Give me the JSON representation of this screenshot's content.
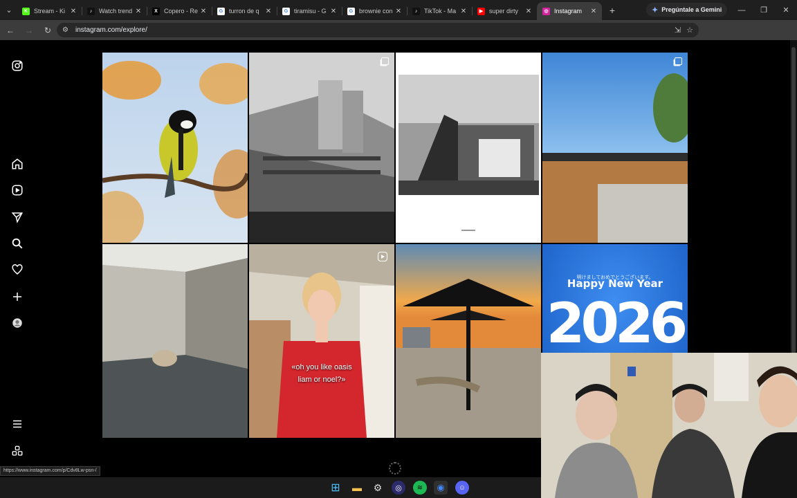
{
  "browser": {
    "tabs": [
      {
        "title": "Stream - Ki",
        "favicon": "kick-icon",
        "color": "#53fc18",
        "glyph": "K"
      },
      {
        "title": "Watch trend",
        "favicon": "tiktok-icon",
        "color": "#111111",
        "glyph": "♪"
      },
      {
        "title": "Copero - Re",
        "favicon": "x-icon",
        "color": "#000000",
        "glyph": "X"
      },
      {
        "title": "turron de q",
        "favicon": "google-icon",
        "color": "#ffffff",
        "glyph": "G"
      },
      {
        "title": "tiramisu - G",
        "favicon": "google-icon",
        "color": "#ffffff",
        "glyph": "G"
      },
      {
        "title": "brownie con",
        "favicon": "google-icon",
        "color": "#ffffff",
        "glyph": "G"
      },
      {
        "title": "TikTok - Ma",
        "favicon": "tiktok-icon",
        "color": "#111111",
        "glyph": "♪"
      },
      {
        "title": "super dirty",
        "favicon": "youtube-icon",
        "color": "#ff0000",
        "glyph": "▶"
      },
      {
        "title": "Instagram",
        "favicon": "instagram-icon",
        "color": "#d6249f",
        "glyph": "◎",
        "active": true
      }
    ],
    "gemini_label": "Pregúntale a Gemini",
    "url": "instagram.com/explore/",
    "status_url": "https://www.instagram.com/p/Cdv8Lw-psn-/"
  },
  "sidebar": {
    "items": [
      "instagram-logo-icon",
      "home-icon",
      "reels-icon",
      "messages-icon",
      "search-icon",
      "notifications-icon",
      "create-icon",
      "profile-avatar",
      "more-menu-icon",
      "also-from-meta-icon"
    ]
  },
  "posts": [
    {
      "name": "post-bird",
      "kind": "photo"
    },
    {
      "name": "post-brutalist-building",
      "kind": "carousel"
    },
    {
      "name": "post-modern-house-bw",
      "kind": "photo"
    },
    {
      "name": "post-wood-concrete-wall",
      "kind": "carousel"
    },
    {
      "name": "post-stone-courtyard",
      "kind": "photo"
    },
    {
      "name": "post-red-polo-reel",
      "kind": "reel",
      "caption_line1": "«oh you like oasis",
      "caption_line2": "liam or noel?»"
    },
    {
      "name": "post-beach-umbrella",
      "kind": "photo"
    },
    {
      "name": "post-happy-new-year",
      "kind": "photo",
      "small_text": "明けましておめでとうございます。",
      "title": "Happy New Year",
      "number": "2026"
    }
  ],
  "colors": {
    "background": "#000000",
    "tab_bar": "#1f1f1f",
    "toolbar": "#3c3c3c",
    "omnibox": "#282828",
    "ny_blue": "#1b6fe0"
  }
}
